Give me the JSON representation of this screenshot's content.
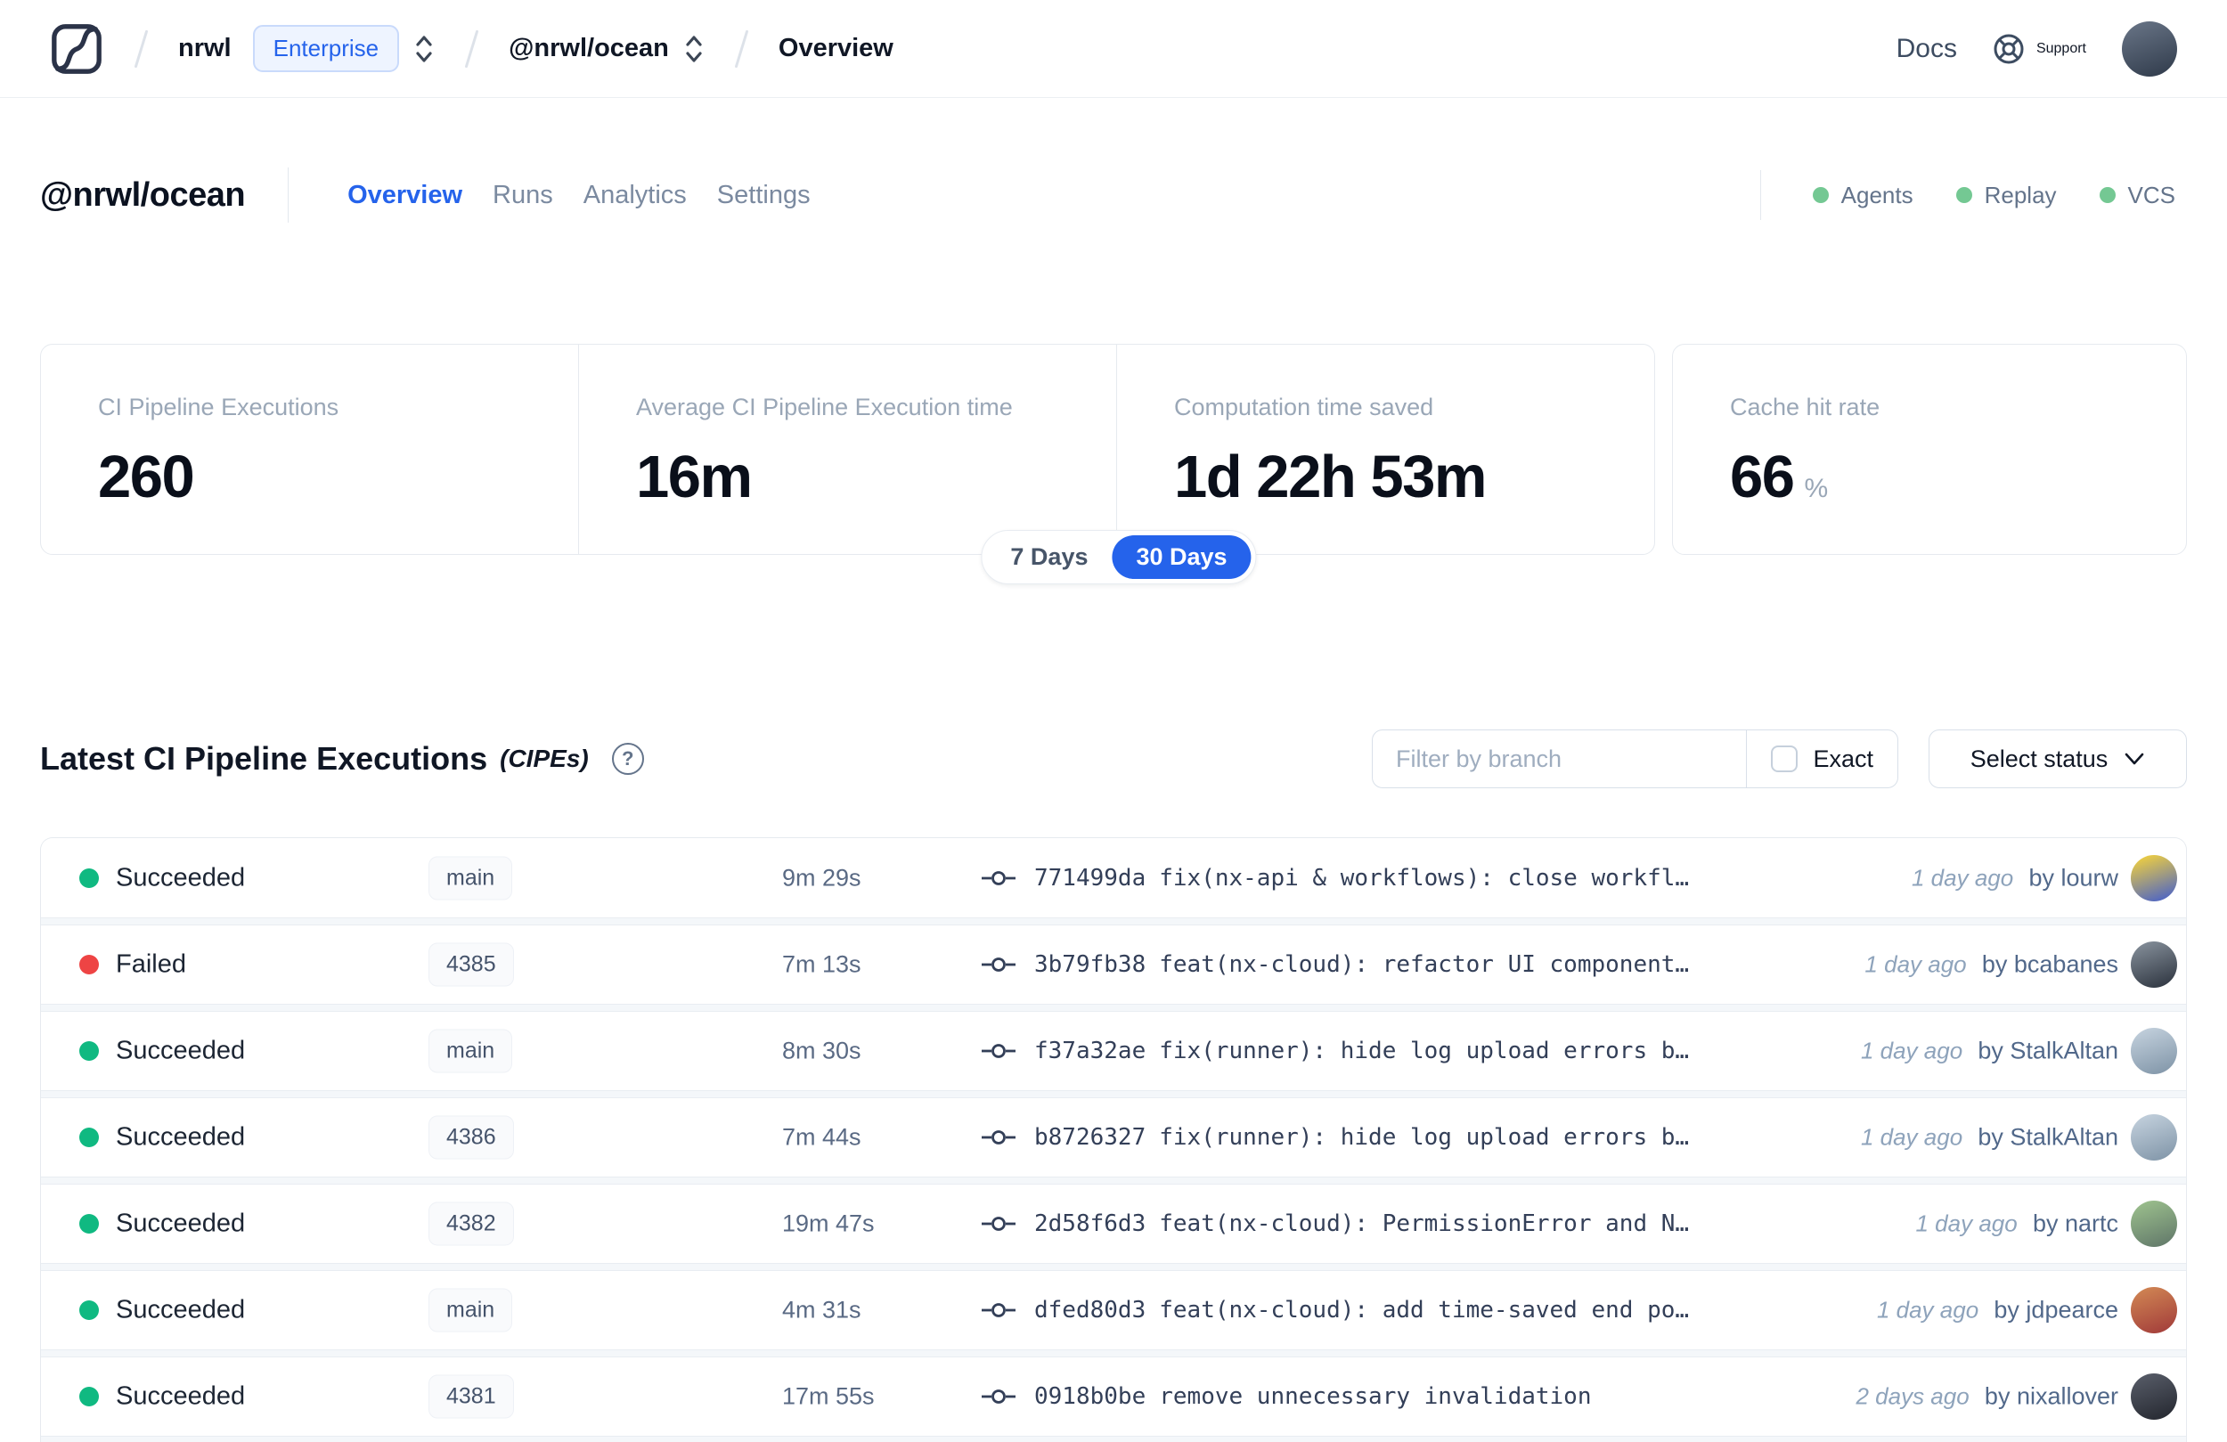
{
  "header": {
    "org": "nrwl",
    "plan_badge": "Enterprise",
    "workspace": "@nrwl/ocean",
    "page": "Overview",
    "docs_label": "Docs",
    "support_label": "Support",
    "avatar_gradient": [
      "#6a7688",
      "#2f3a4a"
    ]
  },
  "workspace_header": {
    "title": "@nrwl/ocean",
    "tabs": [
      {
        "label": "Overview",
        "active": true
      },
      {
        "label": "Runs",
        "active": false
      },
      {
        "label": "Analytics",
        "active": false
      },
      {
        "label": "Settings",
        "active": false
      }
    ],
    "features": [
      {
        "label": "Agents"
      },
      {
        "label": "Replay"
      },
      {
        "label": "VCS"
      }
    ],
    "feature_dot_color": "#74c893"
  },
  "stats": {
    "cards": [
      {
        "label": "CI Pipeline Executions",
        "value": "260"
      },
      {
        "label": "Average CI Pipeline Execution time",
        "value": "16m"
      },
      {
        "label": "Computation time saved",
        "value": "1d 22h 53m"
      },
      {
        "label": "Cache hit rate",
        "value": "66",
        "unit": "%"
      }
    ],
    "range_toggle": {
      "options": [
        "7 Days",
        "30 Days"
      ],
      "selected": "30 Days",
      "active_color": "#2563eb"
    }
  },
  "cipe_section": {
    "title": "Latest CI Pipeline Executions",
    "subtitle": "(CIPEs)",
    "help_icon": "?",
    "filter_placeholder": "Filter by branch",
    "exact_label": "Exact",
    "status_select_label": "Select status",
    "status_colors": {
      "succeeded": "#10b981",
      "failed": "#ee4444"
    },
    "rows": [
      {
        "status": "Succeeded",
        "status_color": "#10b981",
        "branch": "main",
        "duration": "9m 29s",
        "commit_hash": "771499da",
        "commit_message": "fix(nx-api & workflows): close workfl…",
        "time": "1 day ago",
        "author": "by lourw",
        "avatar_gradient": [
          "#fdd835",
          "#3f5bd0"
        ]
      },
      {
        "status": "Failed",
        "status_color": "#ee4444",
        "branch": "4385",
        "duration": "7m 13s",
        "commit_hash": "3b79fb38",
        "commit_message": "feat(nx-cloud): refactor UI component…",
        "time": "1 day ago",
        "author": "by bcabanes",
        "avatar_gradient": [
          "#8a949f",
          "#2a313c"
        ]
      },
      {
        "status": "Succeeded",
        "status_color": "#10b981",
        "branch": "main",
        "duration": "8m 30s",
        "commit_hash": "f37a32ae",
        "commit_message": "fix(runner): hide log upload errors b…",
        "time": "1 day ago",
        "author": "by StalkAltan",
        "avatar_gradient": [
          "#c7d4e0",
          "#7e93a6"
        ]
      },
      {
        "status": "Succeeded",
        "status_color": "#10b981",
        "branch": "4386",
        "duration": "7m 44s",
        "commit_hash": "b8726327",
        "commit_message": "fix(runner): hide log upload errors b…",
        "time": "1 day ago",
        "author": "by StalkAltan",
        "avatar_gradient": [
          "#c7d4e0",
          "#7e93a6"
        ]
      },
      {
        "status": "Succeeded",
        "status_color": "#10b981",
        "branch": "4382",
        "duration": "19m 47s",
        "commit_hash": "2d58f6d3",
        "commit_message": "feat(nx-cloud): PermissionError and N…",
        "time": "1 day ago",
        "author": "by nartc",
        "avatar_gradient": [
          "#9fc48f",
          "#5f7568"
        ]
      },
      {
        "status": "Succeeded",
        "status_color": "#10b981",
        "branch": "main",
        "duration": "4m 31s",
        "commit_hash": "dfed80d3",
        "commit_message": "feat(nx-cloud): add time-saved end po…",
        "time": "1 day ago",
        "author": "by jdpearce",
        "avatar_gradient": [
          "#d38a55",
          "#a03939"
        ]
      },
      {
        "status": "Succeeded",
        "status_color": "#10b981",
        "branch": "4381",
        "duration": "17m 55s",
        "commit_hash": "0918b0be",
        "commit_message": "remove unnecessary invalidation",
        "time": "2 days ago",
        "author": "by nixallover",
        "avatar_gradient": [
          "#5a5f6b",
          "#23262e"
        ]
      }
    ]
  },
  "colors": {
    "accent_blue": "#2563eb",
    "success_green": "#10b981",
    "failed_red": "#ee4444",
    "border_light": "#e6eaef"
  }
}
